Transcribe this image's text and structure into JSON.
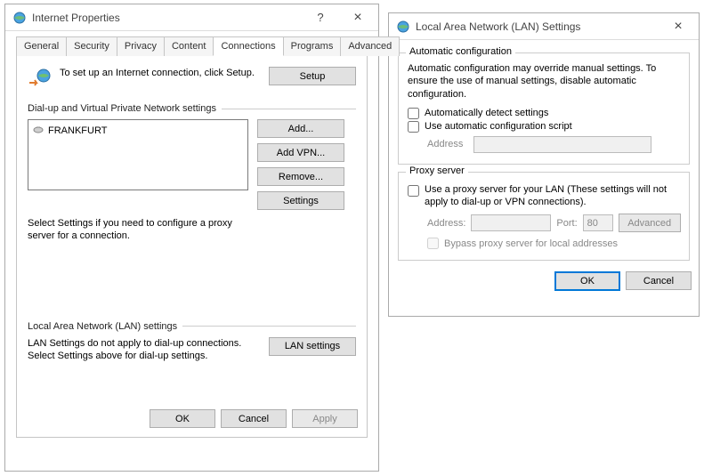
{
  "ip": {
    "title": "Internet Properties",
    "help": "?",
    "close": "×",
    "tabs": [
      "General",
      "Security",
      "Privacy",
      "Content",
      "Connections",
      "Programs",
      "Advanced"
    ],
    "active_tab": "Connections",
    "setup_text": "To set up an Internet connection, click Setup.",
    "setup_btn": "Setup",
    "dialup_label": "Dial-up and Virtual Private Network settings",
    "conn_item": "FRANKFURT",
    "buttons": {
      "add": "Add...",
      "addvpn": "Add VPN...",
      "remove": "Remove...",
      "settings": "Settings"
    },
    "select_settings_text": "Select Settings if you need to configure a proxy server for a connection.",
    "lan_label": "Local Area Network (LAN) settings",
    "lan_text": "LAN Settings do not apply to dial-up connections. Select Settings above for dial-up settings.",
    "lan_btn": "LAN settings",
    "ok": "OK",
    "cancel": "Cancel",
    "apply": "Apply"
  },
  "lan": {
    "title": "Local Area Network (LAN) Settings",
    "close": "×",
    "auto_group": "Automatic configuration",
    "auto_text": "Automatic configuration may override manual settings. To ensure the use of manual settings, disable automatic configuration.",
    "auto_detect": "Automatically detect settings",
    "auto_script": "Use automatic configuration script",
    "address_label": "Address",
    "proxy_group": "Proxy server",
    "proxy_chk": "Use a proxy server for your LAN (These settings will not apply to dial-up or VPN connections).",
    "proxy_addr_label": "Address:",
    "proxy_port_label": "Port:",
    "proxy_port": "80",
    "advanced": "Advanced",
    "bypass": "Bypass proxy server for local addresses",
    "ok": "OK",
    "cancel": "Cancel"
  }
}
